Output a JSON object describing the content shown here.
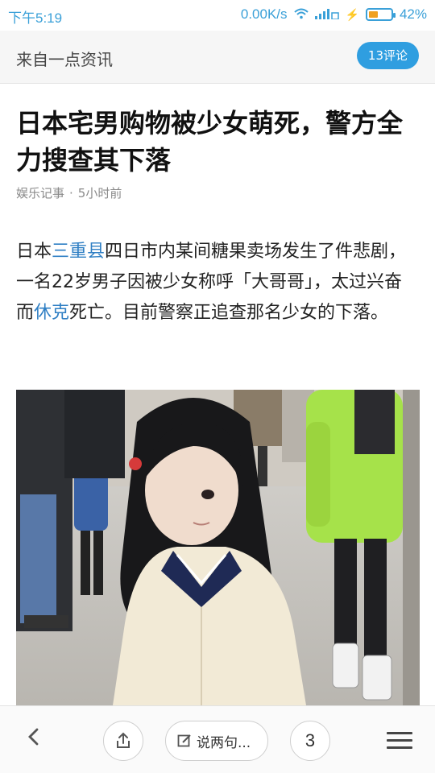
{
  "status_bar": {
    "time": "下午5:19",
    "network_speed": "0.00K/s",
    "battery_percent": "42%",
    "battery_level": 0.42,
    "accent_color": "#3aa0d8"
  },
  "header": {
    "source": "来自一点资讯",
    "comments_label": "13评论"
  },
  "article": {
    "title": "日本宅男购物被少女萌死，警方全力搜查其下落",
    "category": "娱乐记事",
    "time_ago": "5小时前",
    "body": {
      "part1": "日本",
      "link1": "三重县",
      "part2": "四日市内某间糖果卖场发生了件悲剧，一名22岁男子因被少女称呼「大哥哥」，太过兴奋而",
      "link2": "休克",
      "part3": "死亡。目前警察正追查那名少女的下落。"
    }
  },
  "bottom_bar": {
    "back_icon": "chevron-left-icon",
    "share_icon": "share-icon",
    "comment_placeholder": "说两句...",
    "count": "3",
    "menu_icon": "menu-icon"
  }
}
